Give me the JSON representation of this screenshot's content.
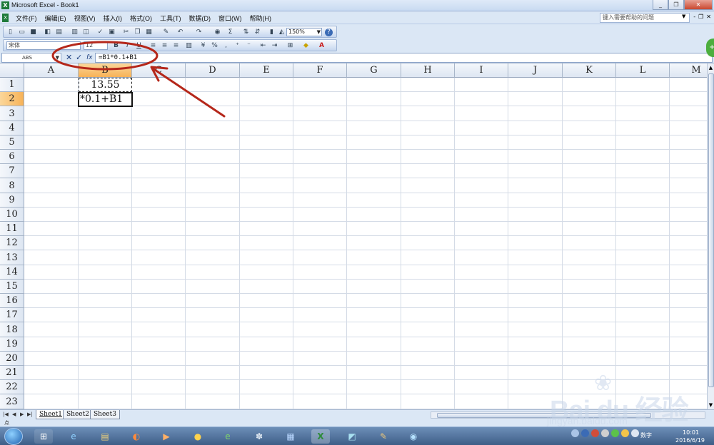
{
  "window": {
    "title": "Microsoft Excel - Book1",
    "app_icon": "excel-icon",
    "buttons": [
      "_",
      "❐",
      "✕"
    ]
  },
  "menubar": {
    "items": [
      "文件(F)",
      "编辑(E)",
      "视图(V)",
      "插入(I)",
      "格式(O)",
      "工具(T)",
      "数据(D)",
      "窗口(W)",
      "帮助(H)"
    ],
    "help_placeholder": "键入需要帮助的问题",
    "doc_buttons": [
      "-",
      "❐",
      "✕"
    ]
  },
  "toolbar": {
    "zoom": "150%",
    "font_name": "宋体",
    "font_size": "12",
    "bold": "B",
    "italic": "I",
    "underline": "U",
    "autosum": "Σ"
  },
  "formula_bar": {
    "name_box": "ABS",
    "cancel": "✕",
    "enter": "✓",
    "fx": "fx",
    "formula": "=B1*0.1+B1"
  },
  "grid": {
    "columns": [
      "A",
      "B",
      "C",
      "D",
      "E",
      "F",
      "G",
      "H",
      "I",
      "J",
      "K",
      "L",
      "M"
    ],
    "rows": [
      "1",
      "2",
      "3",
      "4",
      "5",
      "6",
      "7",
      "8",
      "9",
      "10",
      "11",
      "12",
      "13",
      "14",
      "15",
      "16",
      "17",
      "18",
      "19",
      "20",
      "21",
      "22",
      "23"
    ],
    "active_column": "B",
    "active_row": "2",
    "cells": {
      "B1": "13.55",
      "B2": "*0.1+B1"
    }
  },
  "sheets": [
    "Sheet1",
    "Sheet2",
    "Sheet3"
  ],
  "active_sheet": "Sheet1",
  "status": {
    "mode": "点"
  },
  "taskbar": {
    "ime": "数字",
    "time": "10:01",
    "date": "2016/6/19"
  },
  "watermark": {
    "brand": "Bai du 经验",
    "sub": "jingyan.baidu.com"
  },
  "colors": {
    "accent_header": "#f7b257",
    "annotation_red": "#b5271a"
  }
}
